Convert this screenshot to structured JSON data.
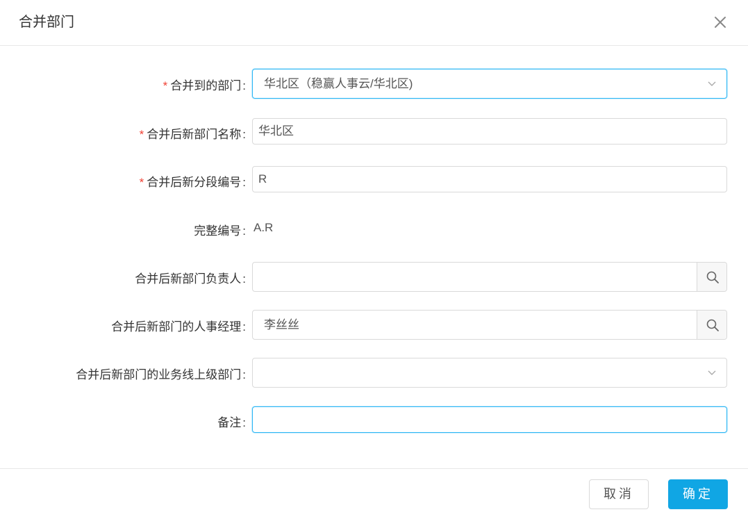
{
  "dialog": {
    "title": "合并部门",
    "close_icon": "close-icon"
  },
  "form": {
    "merge_target": {
      "required": true,
      "label": "合并到的部门",
      "value": "华北区（稳赢人事云/华北区)"
    },
    "new_name": {
      "required": true,
      "label": "合并后新部门名称",
      "value": "华北区"
    },
    "new_segment_code": {
      "required": true,
      "label": "合并后新分段编号",
      "value": "R"
    },
    "full_code": {
      "label": "完整编号",
      "value": "A.R"
    },
    "new_head": {
      "label": "合并后新部门负责人",
      "value": ""
    },
    "new_hr_manager": {
      "label": "合并后新部门的人事经理",
      "value": "李丝丝"
    },
    "new_business_parent": {
      "label": "合并后新部门的业务线上级部门",
      "value": ""
    },
    "remark": {
      "label": "备注",
      "value": ""
    }
  },
  "footer": {
    "cancel_label": "取消",
    "ok_label": "确定"
  },
  "colors": {
    "accent": "#10a6e4",
    "required": "#f04134",
    "focus_border": "#2db7f5"
  },
  "icons": [
    "close-icon",
    "chevron-down-icon",
    "search-icon"
  ]
}
